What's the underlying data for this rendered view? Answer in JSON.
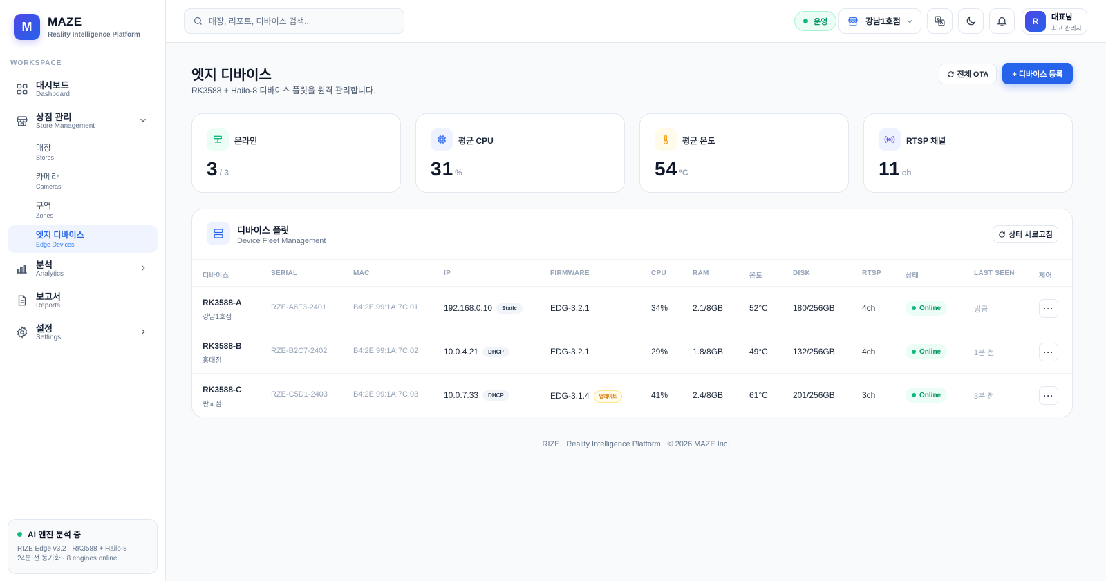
{
  "brand": {
    "logo_letter": "M",
    "name": "MAZE",
    "subtitle": "Reality Intelligence Platform"
  },
  "sidebar": {
    "section_label": "WORKSPACE",
    "dashboard": {
      "label": "대시보드",
      "sub": "Dashboard"
    },
    "store_mgmt": {
      "label": "상점 관리",
      "sub": "Store Management"
    },
    "sub_items": [
      {
        "label": "매장",
        "sub": "Stores"
      },
      {
        "label": "카메라",
        "sub": "Cameras"
      },
      {
        "label": "구역",
        "sub": "Zones"
      },
      {
        "label": "엣지 디바이스",
        "sub": "Edge Devices"
      }
    ],
    "analytics": {
      "label": "분석",
      "sub": "Analytics"
    },
    "reports": {
      "label": "보고서",
      "sub": "Reports"
    },
    "settings": {
      "label": "설정",
      "sub": "Settings"
    },
    "ai_card": {
      "title": "AI 엔진 분석 중",
      "line1": "RIZE Edge v3.2 · RK3588 + Hailo-8",
      "line2": "24분 전 동기화 · 8 engines online"
    }
  },
  "topbar": {
    "search_placeholder": "매장, 리포트, 디바이스 검색...",
    "status": "운영",
    "store": "강남1호점",
    "user": {
      "initial": "R",
      "name": "대표님",
      "role": "최고 관리자"
    }
  },
  "page": {
    "title": "엣지 디바이스",
    "subtitle": "RK3588 + Hailo-8 디바이스 플릿을 원격 관리합니다.",
    "ota_button": "전체 OTA",
    "register_button": "+ 디바이스 등록"
  },
  "stats": [
    {
      "label": "온라인",
      "value": "3",
      "unit": "/ 3"
    },
    {
      "label": "평균 CPU",
      "value": "31",
      "unit": "%"
    },
    {
      "label": "평균 온도",
      "value": "54",
      "unit": "°C"
    },
    {
      "label": "RTSP 채널",
      "value": "11",
      "unit": "ch"
    }
  ],
  "fleet": {
    "title": "디바이스 플릿",
    "subtitle": "Device Fleet Management",
    "refresh": "상태 새로고침",
    "columns": [
      "디바이스",
      "SERIAL",
      "MAC",
      "IP",
      "FIRMWARE",
      "CPU",
      "RAM",
      "온도",
      "DISK",
      "RTSP",
      "상태",
      "LAST SEEN",
      "제어"
    ],
    "rows": [
      {
        "name": "RK3588-A",
        "store": "강남1호점",
        "serial": "RZE-A8F3-2401",
        "mac": "B4:2E:99:1A:7C:01",
        "ip": "192.168.0.10",
        "ip_mode": "Static",
        "firmware": "EDG-3.2.1",
        "fw_badge": "",
        "cpu": "34%",
        "ram": "2.1/8GB",
        "temp": "52°C",
        "disk": "180/256GB",
        "rtsp": "4ch",
        "status": "Online",
        "last_seen": "방금",
        "more": "···"
      },
      {
        "name": "RK3588-B",
        "store": "홍대점",
        "serial": "RZE-B2C7-2402",
        "mac": "B4:2E:99:1A:7C:02",
        "ip": "10.0.4.21",
        "ip_mode": "DHCP",
        "firmware": "EDG-3.2.1",
        "fw_badge": "",
        "cpu": "29%",
        "ram": "1.8/8GB",
        "temp": "49°C",
        "disk": "132/256GB",
        "rtsp": "4ch",
        "status": "Online",
        "last_seen": "1분 전",
        "more": "···"
      },
      {
        "name": "RK3588-C",
        "store": "판교점",
        "serial": "RZE-C5D1-2403",
        "mac": "B4:2E:99:1A:7C:03",
        "ip": "10.0.7.33",
        "ip_mode": "DHCP",
        "firmware": "EDG-3.1.4",
        "fw_badge": "업데이트",
        "cpu": "41%",
        "ram": "2.4/8GB",
        "temp": "61°C",
        "disk": "201/256GB",
        "rtsp": "3ch",
        "status": "Online",
        "last_seen": "3분 전",
        "more": "···"
      }
    ]
  },
  "footer": "RIZE · Reality Intelligence Platform · © 2026 MAZE Inc.",
  "colors": {
    "accent": "#2563eb",
    "online": "#059669",
    "warning": "#d97706"
  }
}
